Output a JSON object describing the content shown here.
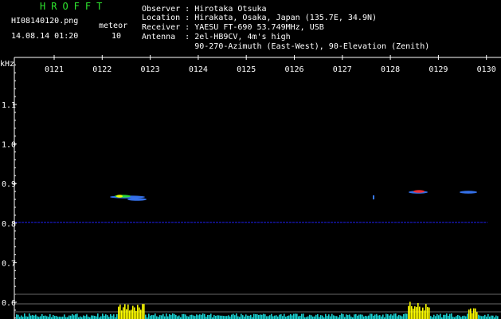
{
  "header": {
    "app_title": "HROFFT",
    "filename": "HI08140120.png",
    "datetime": "14.08.14 01:20",
    "meteor_label": "meteor",
    "meteor_count": "10"
  },
  "station": {
    "observer": "Observer : Hirotaka Otsuka",
    "location": "Location : Hirakata, Osaka, Japan (135.7E, 34.9N)",
    "receiver": "Receiver : YAESU FT-690 53.749MHz, USB",
    "antenna": "Antenna  : 2el-HB9CV, 4m's high",
    "antenna2": "           90-270-Azimuth (East-West), 90-Elevation (Zenith)"
  },
  "spectrogram": {
    "y_unit": "kHz",
    "time_ticks": [
      "0121",
      "0122",
      "0123",
      "0124",
      "0125",
      "0126",
      "0127",
      "0128",
      "0129",
      "0130"
    ],
    "freq_ticks": [
      "1.1",
      "1.0",
      "0.9",
      "0.8",
      "0.7",
      "0.6"
    ],
    "colors": {
      "axis": "#ffffff",
      "baseline": "#1b1bd6",
      "activity_high": "#ffff00",
      "activity_low": "#19d3d3",
      "echo_hot": "#ff2a2a",
      "echo_mid": "#2ee52e",
      "echo_cool": "#3a7bff"
    }
  }
}
